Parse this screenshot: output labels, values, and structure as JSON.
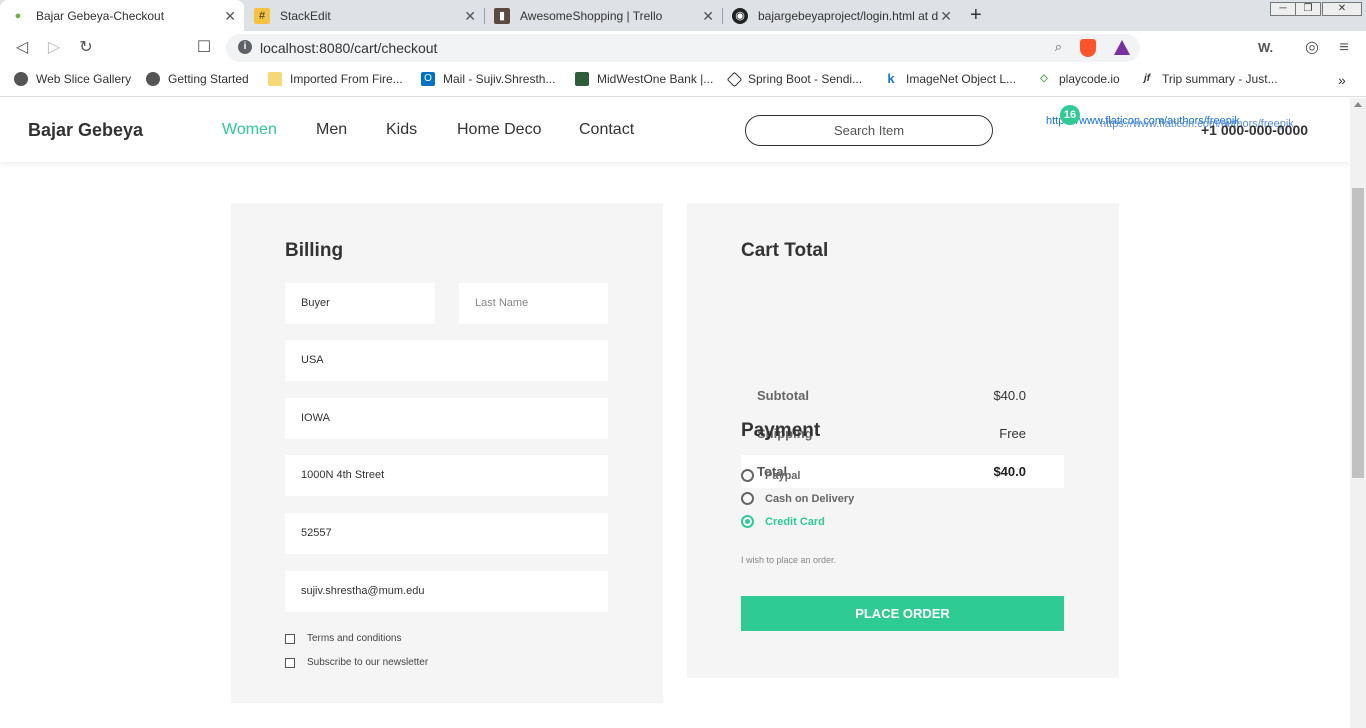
{
  "browser": {
    "tabs": [
      {
        "title": "Bajar Gebeya-Checkout",
        "active": true
      },
      {
        "title": "StackEdit"
      },
      {
        "title": "AwesomeShopping | Trello"
      },
      {
        "title": "bajargebeyaproject/login.html at d"
      }
    ],
    "new_tab": "+",
    "url": "localhost:8080/cart/checkout",
    "bookmarks": [
      "Web Slice Gallery",
      "Getting Started",
      "Imported From Fire...",
      "Mail - Sujiv.Shresth...",
      "MidWestOne Bank |...",
      "Spring Boot - Sendi...",
      "ImageNet Object L...",
      "playcode.io",
      "Trip summary - Just..."
    ],
    "ext_w": "W.",
    "more": "»"
  },
  "header": {
    "logo": "Bajar Gebeya",
    "nav": [
      "Women",
      "Men",
      "Kids",
      "Home Deco",
      "Contact"
    ],
    "search_placeholder": "Search Item",
    "badge_count": "16",
    "img_alt_1": "https://www.flaticon.com/authors/freepik",
    "img_alt_2": "https://www.flaticon.com/authors/freepik",
    "phone": "+1 000-000-0000"
  },
  "billing": {
    "title": "Billing",
    "first_name": "Buyer",
    "last_name_placeholder": "Last Name",
    "country": "USA",
    "state": "IOWA",
    "street": "1000N 4th Street",
    "zip": "52557",
    "email": "sujiv.shrestha@mum.edu",
    "terms": "Terms and conditions",
    "newsletter": "Subscribe to our newsletter"
  },
  "cart": {
    "title": "Cart Total",
    "subtotal_label": "Subtotal",
    "subtotal_value": "$40.0",
    "shipping_label": "Shipping",
    "shipping_value": "Free",
    "total_label": "Total",
    "total_value": "$40.0"
  },
  "payment": {
    "title": "Payment",
    "options": [
      "Paypal",
      "Cash on Delivery",
      "Credit Card"
    ],
    "selected": "Credit Card",
    "wish": "I wish to place an order.",
    "button": "PLACE ORDER"
  },
  "colors": {
    "accent": "#2ecc94",
    "panel": "#f5f5f5"
  }
}
